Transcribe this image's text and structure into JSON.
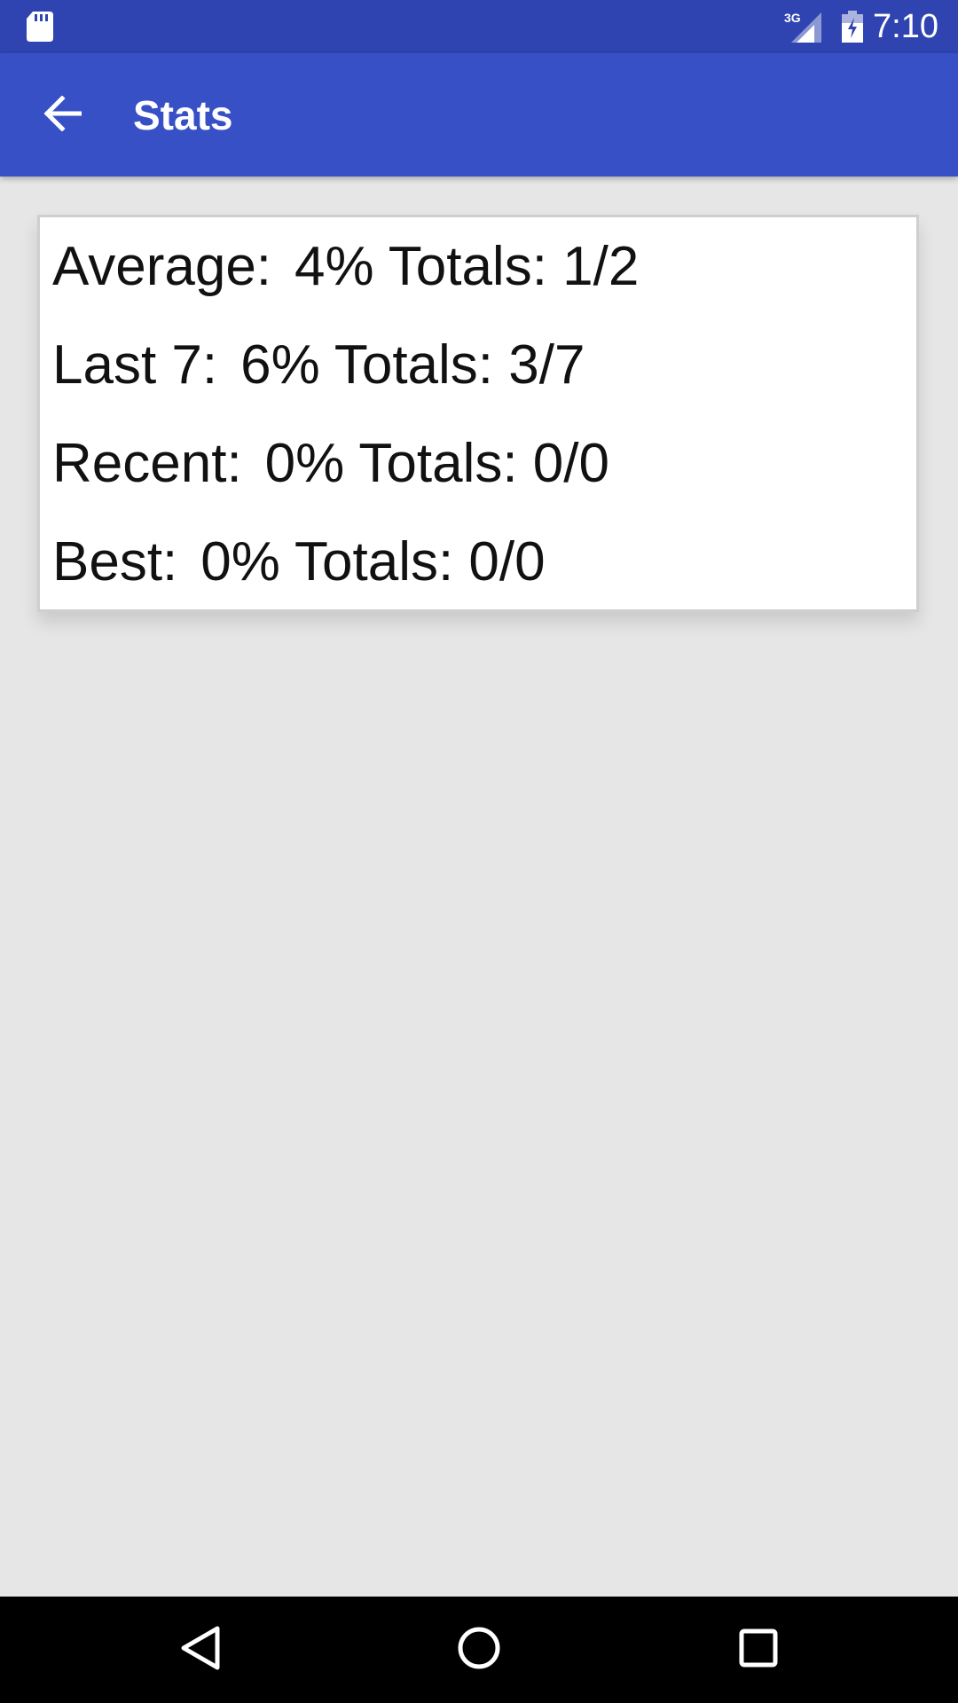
{
  "status_bar": {
    "time": "7:10",
    "network_type": "3G",
    "icons": [
      "sd-card-icon",
      "signal-icon",
      "battery-icon"
    ]
  },
  "app_bar": {
    "title": "Stats",
    "back_icon": "arrow-back-icon",
    "color": "#3750c6"
  },
  "stats": [
    {
      "label": "Average:",
      "value": "4% Totals: 1/2"
    },
    {
      "label": "Last 7:",
      "value": "6% Totals: 3/7"
    },
    {
      "label": "Recent:",
      "value": "0% Totals: 0/0"
    },
    {
      "label": "Best:",
      "value": "0% Totals: 0/0"
    }
  ],
  "nav_bar": {
    "icons": [
      "nav-back-icon",
      "nav-home-icon",
      "nav-recents-icon"
    ]
  },
  "colors": {
    "status_bar": "#2f44b0",
    "app_bar": "#3750c6",
    "background": "#e6e6e6",
    "card": "#ffffff",
    "nav_bar": "#000000"
  }
}
